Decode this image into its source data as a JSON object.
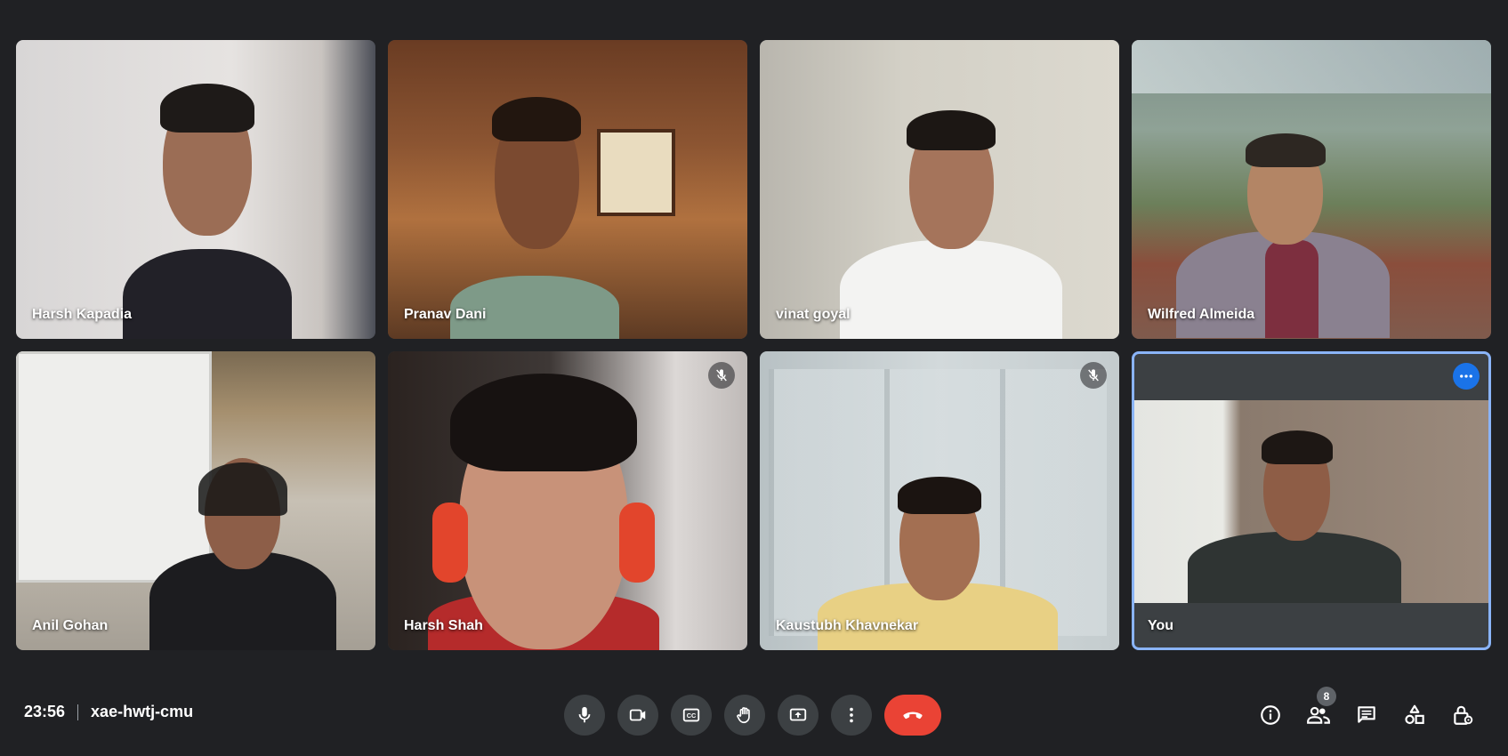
{
  "participants": [
    {
      "name": "Harsh Kapadia",
      "muted": false
    },
    {
      "name": "Pranav Dani",
      "muted": false
    },
    {
      "name": "vinat goyal",
      "muted": false
    },
    {
      "name": "Wilfred Almeida",
      "muted": false
    },
    {
      "name": "Anil Gohan",
      "muted": false
    },
    {
      "name": "Harsh Shah",
      "muted": true
    },
    {
      "name": "Kaustubh Khavnekar",
      "muted": true
    },
    {
      "name": "You",
      "muted": false,
      "active_speaker_highlight": true
    }
  ],
  "meeting": {
    "time": "23:56",
    "code": "xae-hwtj-cmu"
  },
  "controls": [
    "microphone-icon",
    "camera-icon",
    "captions-icon",
    "raise-hand-icon",
    "present-screen-icon",
    "more-options-icon",
    "hang-up-icon"
  ],
  "right_panel": {
    "people_count": "8",
    "icons": [
      "info-icon",
      "people-icon",
      "chat-icon",
      "activities-icon",
      "host-controls-icon"
    ]
  },
  "colors": {
    "background": "#202124",
    "tile": "#3c4043",
    "hangup": "#ea4335",
    "highlight": "#8ab4f8",
    "accent": "#1a73e8"
  }
}
